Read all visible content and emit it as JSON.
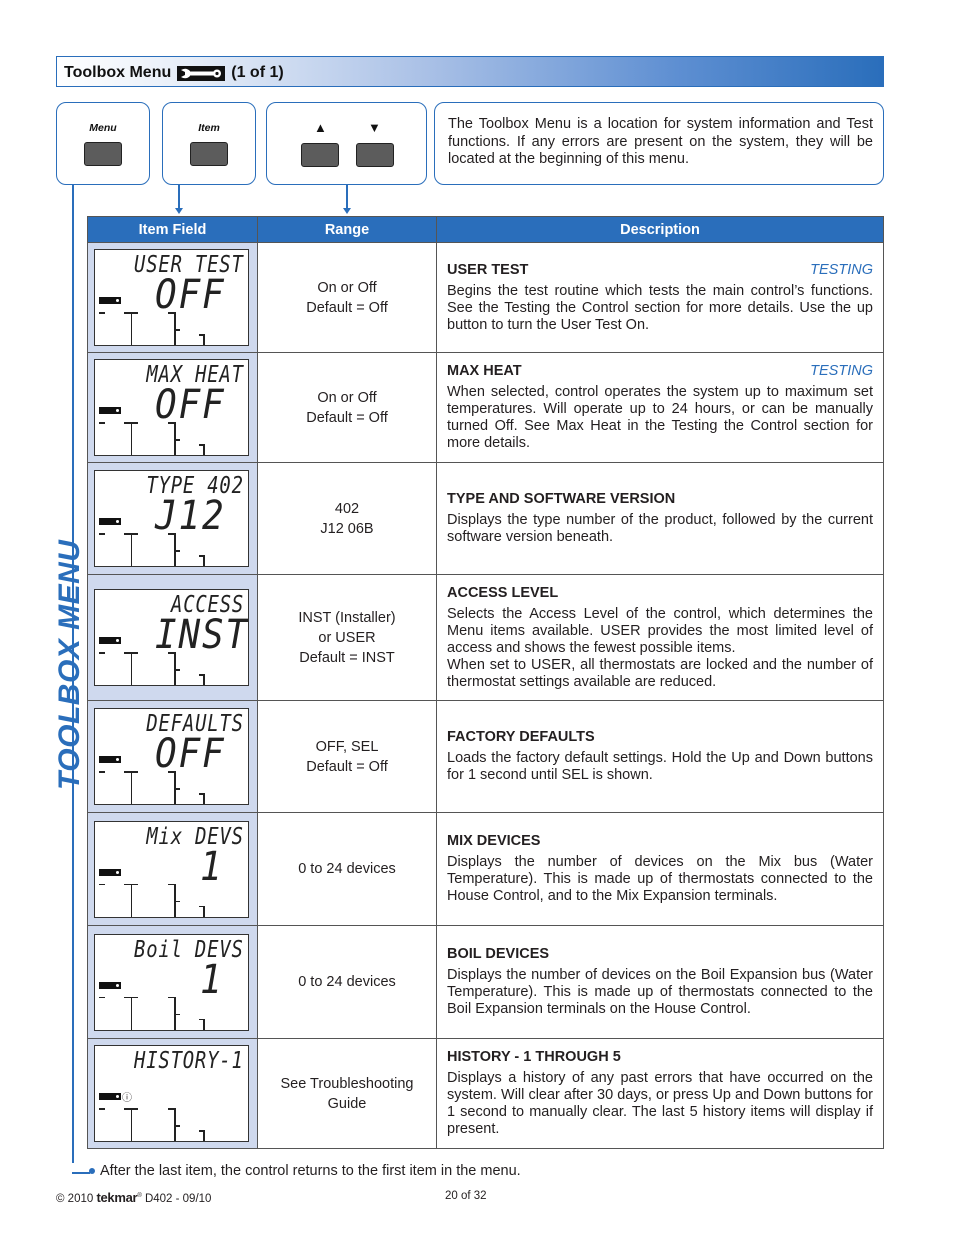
{
  "header": {
    "title": "Toolbox Menu",
    "title_icon": "wrench-icon",
    "page_indicator": "(1 of 1)"
  },
  "controls": {
    "menu_label": "Menu",
    "item_label": "Item",
    "up_arrow": "▲",
    "down_arrow": "▼"
  },
  "intro": "The Toolbox Menu is a location for system information and Test functions. If any errors are present on the system, they will be located at the beginning of this menu.",
  "side_label": "TOOLBOX MENU",
  "table": {
    "columns": [
      "Item Field",
      "Range",
      "Description"
    ],
    "rows": [
      {
        "lcd_top": "USER TEST",
        "lcd_value": "OFF",
        "range": [
          "On or Off",
          "Default = Off"
        ],
        "title": "USER TEST",
        "tag": "TESTING",
        "description": [
          "Begins the test routine which tests the main control’s functions. See the Testing the Control section for more details. Use the up button to turn the User Test On."
        ]
      },
      {
        "lcd_top": "MAX HEAT",
        "lcd_value": "OFF",
        "range": [
          "On or Off",
          "Default = Off"
        ],
        "title": "MAX HEAT",
        "tag": "TESTING",
        "description": [
          "When selected, control operates the system up to maximum set temperatures. Will operate up to 24 hours, or can be manually turned Off. See Max Heat in the Testing the Control section for more details."
        ]
      },
      {
        "lcd_top": "TYPE 402",
        "lcd_value": "J12",
        "range": [
          "402",
          "J12 06B"
        ],
        "title": "TYPE AND SOFTWARE VERSION",
        "tag": "",
        "description": [
          "Displays the type number of the product, followed by the current software version beneath."
        ]
      },
      {
        "lcd_top": "ACCESS",
        "lcd_value": "INST",
        "range": [
          "INST (Installer)",
          "or USER",
          "Default = INST"
        ],
        "title": "ACCESS LEVEL",
        "tag": "",
        "description": [
          "Selects the Access Level of the control, which determines the Menu items available. USER provides the most limited level of access and shows the fewest possible items.",
          "When set to USER, all thermostats are locked and the number of thermostat settings available are reduced."
        ]
      },
      {
        "lcd_top": "DEFAULTS",
        "lcd_value": "OFF",
        "range": [
          "OFF, SEL",
          "Default = Off"
        ],
        "title": "FACTORY DEFAULTS",
        "tag": "",
        "description": [
          "Loads the factory default settings. Hold the Up and Down buttons for 1 second until SEL is shown."
        ]
      },
      {
        "lcd_top": "Mix DEVS",
        "lcd_value": "1",
        "range": [
          "0 to 24 devices"
        ],
        "title": "MIX DEVICES",
        "tag": "",
        "description": [
          "Displays the number of devices on the Mix bus (Water Temperature). This is made up of thermostats connected to the House Control, and to the Mix Expansion terminals."
        ]
      },
      {
        "lcd_top": "Boil DEVS",
        "lcd_value": "1",
        "range": [
          "0 to 24 devices"
        ],
        "title": "BOIL DEVICES",
        "tag": "",
        "description": [
          "Displays the number of devices on the Boil Expansion bus (Water Temperature). This is made up of thermostats connected to the Boil Expansion terminals on the House Control."
        ]
      },
      {
        "lcd_top": "HISTORY-1",
        "lcd_value": "",
        "range": [
          "See Troubleshooting",
          "Guide"
        ],
        "title": "HISTORY - 1 THROUGH 5",
        "tag": "",
        "description": [
          "Displays a history of any past errors that have occurred on the system. Will clear after 30 days, or press Up and Down buttons for 1 second to manually clear. The last 5 history items will display if present."
        ]
      }
    ]
  },
  "footnote": "After the last item, the control returns to the first item in the menu.",
  "footer": {
    "copyright": "© 2010",
    "brand": "tekmar",
    "doc_id": "D402 - 09/10",
    "page": "20 of 32"
  },
  "colors": {
    "accent": "#2a6ebb",
    "field_bg": "#cfd9ee"
  }
}
